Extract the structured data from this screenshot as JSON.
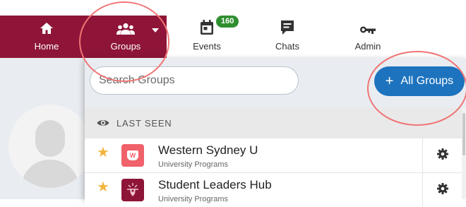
{
  "nav": {
    "items": [
      {
        "label": "Home",
        "icon": "home-icon"
      },
      {
        "label": "Groups",
        "icon": "groups-icon"
      },
      {
        "label": "Events",
        "icon": "calendar-icon",
        "badge": "160"
      },
      {
        "label": "Chats",
        "icon": "chat-icon"
      },
      {
        "label": "Admin",
        "icon": "key-icon"
      }
    ],
    "active_color": "#8e1538",
    "badge_color": "#2f8f2f"
  },
  "dropdown": {
    "search": {
      "placeholder": "Search Groups",
      "value": ""
    },
    "all_groups_button": {
      "plus": "+",
      "label": "All Groups",
      "color": "#1e73be"
    },
    "section": {
      "label": "LAST SEEN",
      "icon": "eye-icon"
    },
    "groups": [
      {
        "name": "Western Sydney U",
        "subtitle": "University Programs",
        "starred": true,
        "logo_text": "W"
      },
      {
        "name": "Student Leaders Hub",
        "subtitle": "University Programs",
        "starred": true
      }
    ]
  },
  "annotation_color": "#f07575"
}
